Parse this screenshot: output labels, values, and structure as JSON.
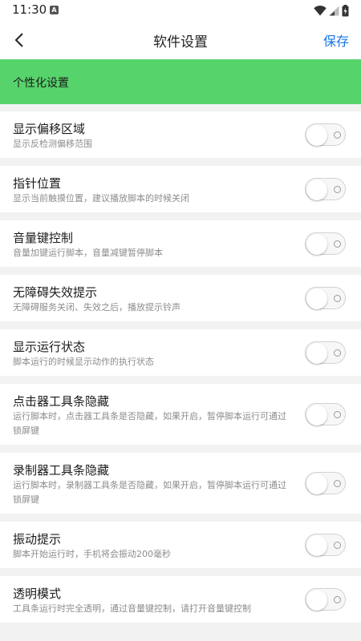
{
  "status_bar": {
    "time": "11:30",
    "notification_icon": "A"
  },
  "app_bar": {
    "title": "软件设置",
    "save_label": "保存"
  },
  "section": {
    "title": "个性化设置"
  },
  "settings": [
    {
      "title": "显示偏移区域",
      "subtitle": "显示反检测偏移范围",
      "enabled": false
    },
    {
      "title": "指针位置",
      "subtitle": "显示当前触摸位置，建议播放脚本的时候关闭",
      "enabled": false
    },
    {
      "title": "音量键控制",
      "subtitle": "音量加键运行脚本，音量减键暂停脚本",
      "enabled": false
    },
    {
      "title": "无障碍失效提示",
      "subtitle": "无障碍服务关闭、失效之后，播放提示铃声",
      "enabled": false
    },
    {
      "title": "显示运行状态",
      "subtitle": "脚本运行的时候显示动作的执行状态",
      "enabled": false
    },
    {
      "title": "点击器工具条隐藏",
      "subtitle": "运行脚本时，点击器工具条是否隐藏，如果开启，暂停脚本运行可通过锁屏键",
      "enabled": false
    },
    {
      "title": "录制器工具条隐藏",
      "subtitle": "运行脚本时，录制器工具条是否隐藏，如果开启，暂停脚本运行可通过锁屏键",
      "enabled": false
    },
    {
      "title": "振动提示",
      "subtitle": "脚本开始运行时，手机将会振动200毫秒",
      "enabled": false
    },
    {
      "title": "透明模式",
      "subtitle": "工具条运行时完全透明，通过音量键控制，请打开音量键控制",
      "enabled": false
    }
  ],
  "colors": {
    "accent": "#1976e6",
    "section_header": "#56d36b"
  }
}
